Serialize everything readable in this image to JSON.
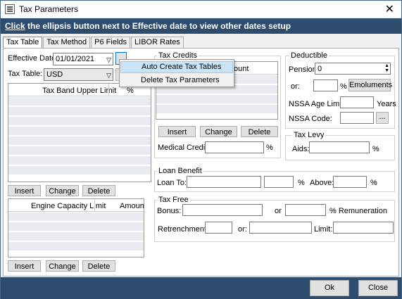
{
  "window": {
    "title": "Tax Parameters",
    "close": "✕"
  },
  "banner": {
    "link": "Click",
    "text": " the ellipsis button next to Effective date to view other dates setup"
  },
  "tabs": [
    {
      "label": "Tax Table"
    },
    {
      "label": "Tax Method"
    },
    {
      "label": "P6 Fields"
    },
    {
      "label": "LIBOR Rates"
    }
  ],
  "left": {
    "effective_date_label": "Effective Date:",
    "effective_date_value": "01/01/2021",
    "tax_table_label": "Tax Table:",
    "tax_table_value": "USD",
    "grid1": {
      "col1": "Tax Band Upper Limit",
      "col2": "%"
    },
    "grid2": {
      "col1": "Engine Capacity Limit",
      "col2": "Amount"
    },
    "insert": "Insert",
    "change": "Change",
    "delete": "Delete"
  },
  "context_menu": {
    "items": [
      {
        "label": "Auto Create Tax Tables"
      },
      {
        "label": "Delete Tax Parameters"
      }
    ]
  },
  "tax_credits": {
    "title": "Tax Credits",
    "col2": "ount",
    "insert": "Insert",
    "change": "Change",
    "delete": "Delete",
    "medical_label": "Medical Credits:",
    "pct": "%"
  },
  "deductible": {
    "title": "Deductible",
    "pension_label": "Pension:",
    "pension_value": "0",
    "or_label": "or:",
    "pct": "%",
    "emoluments": "Emoluments",
    "nssa_age_label": "NSSA Age Limit:",
    "years": "Years",
    "nssa_code_label": "NSSA Code:",
    "ellipsis": "..."
  },
  "tax_levy": {
    "title": "Tax Levy",
    "aids_label": "Aids:",
    "pct": "%"
  },
  "loan_benefit": {
    "title": "Loan Benefit",
    "loan_to_label": "Loan To:",
    "pct": "%",
    "above_label": "Above:",
    "pct2": "%"
  },
  "tax_free": {
    "title": "Tax Free",
    "bonus_label": "Bonus:",
    "or_label": "or",
    "remuneration": "% Remuneration",
    "retrenchment_label": "Retrenchment /",
    "or2_label": "or:",
    "limit_label": "Limit:"
  },
  "footer": {
    "ok": "Ok",
    "close": "Close"
  }
}
